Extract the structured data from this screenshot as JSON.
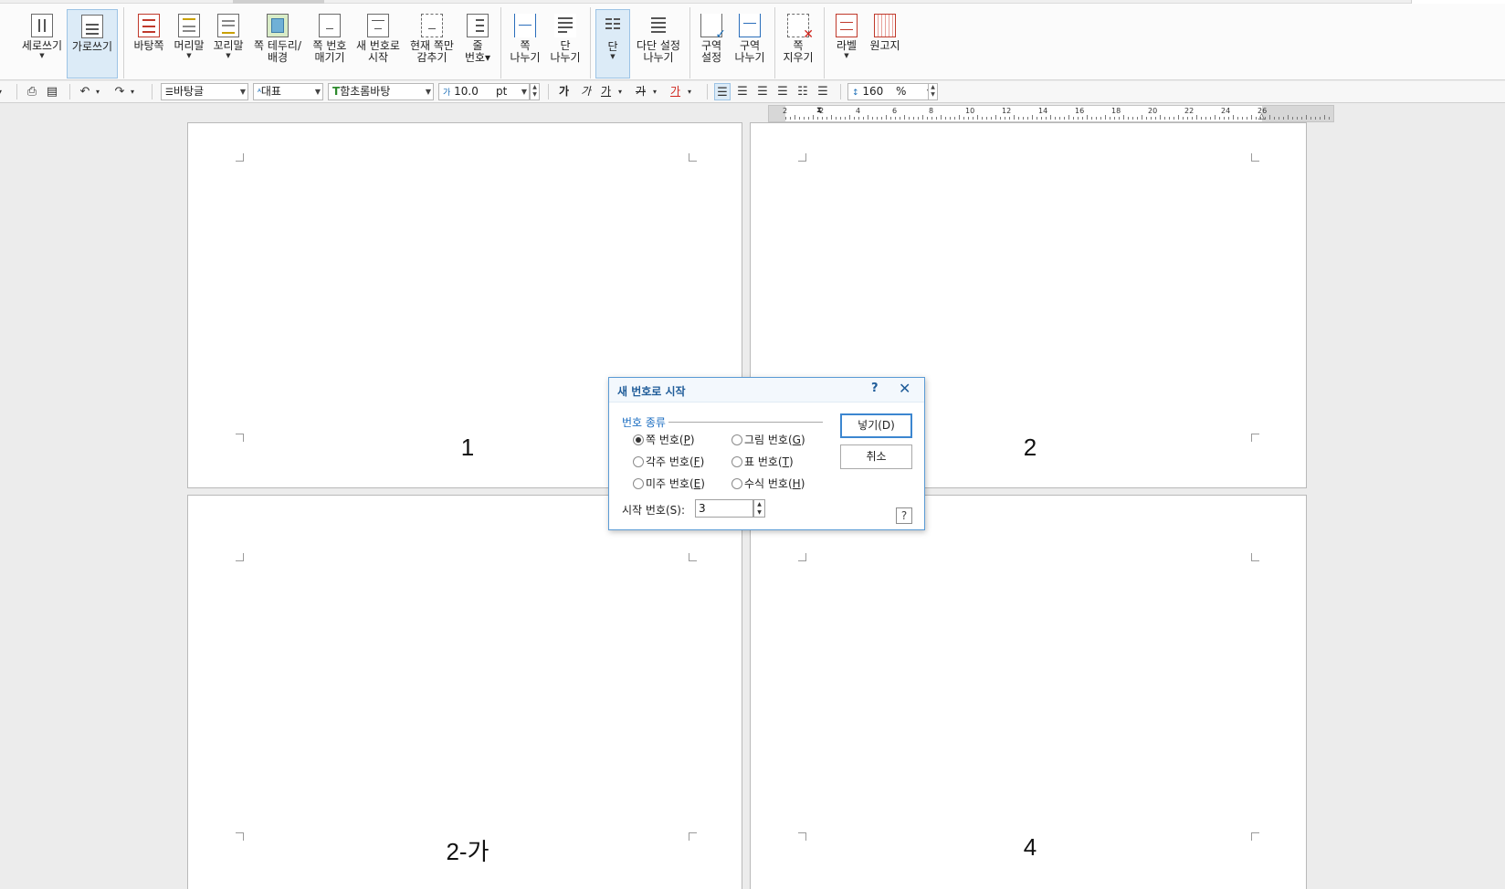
{
  "ribbon": {
    "buttons": [
      {
        "label": "세로쓰기",
        "has_arrow": true
      },
      {
        "label": "가로쓰기",
        "has_arrow": false,
        "active": true
      },
      {
        "label": "바탕쪽",
        "has_arrow": false
      },
      {
        "label": "머리말",
        "has_arrow": true
      },
      {
        "label": "꼬리말",
        "has_arrow": true
      },
      {
        "label": "쪽 테두리/\n배경",
        "has_arrow": false
      },
      {
        "label": "쪽 번호\n매기기",
        "has_arrow": false
      },
      {
        "label": "새 번호로\n시작",
        "has_arrow": false
      },
      {
        "label": "현재 쪽만\n감추기",
        "has_arrow": false
      },
      {
        "label": "줄\n번호▾",
        "has_arrow": false
      },
      {
        "label": "쪽\n나누기",
        "has_arrow": false
      },
      {
        "label": "단\n나누기",
        "has_arrow": false
      },
      {
        "label": "단",
        "has_arrow": true,
        "active": true
      },
      {
        "label": "다단 설정\n나누기",
        "has_arrow": false
      },
      {
        "label": "구역\n설정",
        "has_arrow": false
      },
      {
        "label": "구역\n나누기",
        "has_arrow": false
      },
      {
        "label": "쪽\n지우기",
        "has_arrow": false
      },
      {
        "label": "라벨",
        "has_arrow": true
      },
      {
        "label": "원고지",
        "has_arrow": false
      }
    ]
  },
  "toolbar": {
    "style_combo": "바탕글",
    "lang_combo": "대표",
    "font_combo": "함초롬바탕",
    "size_value": "10.0",
    "size_unit": "pt",
    "bold_glyph": "가",
    "italic_glyph": "가",
    "underline_glyph": "가",
    "strike_glyph": "가",
    "color_glyph": "가",
    "line_spacing_value": "160",
    "line_spacing_unit": "%",
    "accent_red": "#d0261e"
  },
  "ruler": {
    "labels": [
      "2",
      "2",
      "4",
      "6",
      "8",
      "10",
      "12",
      "14",
      "16",
      "18",
      "20",
      "22",
      "24",
      "26"
    ]
  },
  "pages": [
    {
      "number_text": "1"
    },
    {
      "number_text": "2"
    },
    {
      "number_text": "2-가"
    },
    {
      "number_text": "4"
    }
  ],
  "dialog": {
    "title": "새 번호로 시작",
    "help_glyph": "?",
    "close_glyph": "✕",
    "group_label": "번호 종류",
    "options": [
      {
        "text": "쪽 번호(",
        "key": "P",
        "selected": true
      },
      {
        "text": "그림 번호(",
        "key": "G",
        "selected": false
      },
      {
        "text": "각주 번호(",
        "key": "F",
        "selected": false
      },
      {
        "text": "표 번호(",
        "key": "T",
        "selected": false
      },
      {
        "text": "미주 번호(",
        "key": "E",
        "selected": false
      },
      {
        "text": "수식 번호(",
        "key": "H",
        "selected": false
      }
    ],
    "insert_label": "넣기(D)",
    "cancel_label": "취소",
    "start_label": "시작 번호(S):",
    "start_value": "3",
    "question_glyph": "?"
  }
}
